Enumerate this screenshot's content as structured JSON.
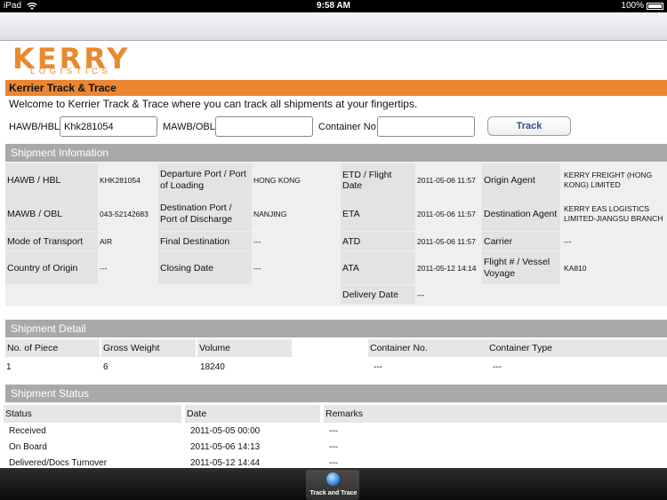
{
  "status_bar": {
    "device": "iPad",
    "time": "9:58 AM",
    "battery": "100%",
    "icons": [
      "wifi-icon",
      "battery-icon"
    ]
  },
  "logo": {
    "word": "KERRY",
    "sub": "LOGISTICS"
  },
  "title": "Kerrier Track & Trace",
  "welcome": "Welcome to Kerrier Track & Trace where you can track all shipments at your fingertips.",
  "search": {
    "hawb_label": "HAWB/HBL",
    "hawb_value": "Khk281054",
    "mawb_label": "MAWB/OBL",
    "mawb_value": "",
    "container_label": "Container No",
    "container_value": "",
    "track_label": "Track"
  },
  "shipment_info": {
    "heading": "Shipment Infomation",
    "hawb_label": "HAWB / HBL",
    "hawb_value": "KHK281054",
    "departure_label": "Departure Port / Port of Loading",
    "departure_value": "HONG KONG",
    "etd_label": "ETD / Flight Date",
    "etd_value": "2011-05-06 11:57",
    "origin_agent_label": "Origin Agent",
    "origin_agent_value": "KERRY FREIGHT (HONG KONG) LIMITED",
    "mawb_label": "MAWB / OBL",
    "mawb_value": "043-52142683",
    "destination_label": "Destination Port / Port of Discharge",
    "destination_value": "NANJING",
    "eta_label": "ETA",
    "eta_value": "2011-05-06 11:57",
    "dest_agent_label": "Destination Agent",
    "dest_agent_value": "KERRY EAS LOGISTICS LIMITED-JIANGSU BRANCH",
    "transport_label": "Mode of Transport",
    "transport_value": "AIR",
    "final_dest_label": "Final Destination",
    "final_dest_value": "---",
    "atd_label": "ATD",
    "atd_value": "2011-05-06 11:57",
    "carrier_label": "Carrier",
    "carrier_value": "---",
    "origin_country_label": "Country of Origin",
    "origin_country_value": "---",
    "closing_label": "Closing Date",
    "closing_value": "---",
    "ata_label": "ATA",
    "ata_value": "2011-05-12 14:14",
    "flight_label": "Flight # / Vessel Voyage",
    "flight_value": "KA810",
    "delivery_label": "Delivery Date",
    "delivery_value": "---"
  },
  "shipment_detail": {
    "heading": "Shipment Detail",
    "columns": [
      "No. of Piece",
      "Gross Weight",
      "Volume",
      "Container No.",
      "Container Type"
    ],
    "row": [
      "1",
      "6",
      "18240",
      "---",
      "---"
    ]
  },
  "shipment_status": {
    "heading": "Shipment Status",
    "columns": [
      "Status",
      "Date",
      "Remarks"
    ],
    "rows": [
      [
        "Received",
        "2011-05-05 00:00",
        "---"
      ],
      [
        "On Board",
        "2011-05-06 14:13",
        "---"
      ],
      [
        "Delivered/Docs Turnover",
        "2011-05-12 14:44",
        "---"
      ]
    ]
  },
  "tab_bar": {
    "tab_label": "Track and Trace",
    "tab_icon": "globe-icon"
  },
  "colors": {
    "accent": "#ea8733",
    "section_header": "#a9a9a9",
    "button_text": "#33508d"
  }
}
